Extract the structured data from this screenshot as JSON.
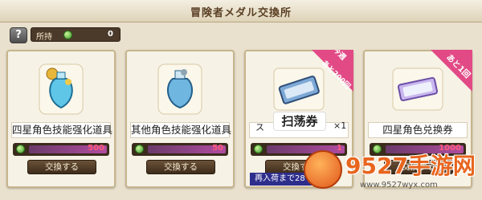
{
  "header": {
    "title": "冒険者メダル交換所"
  },
  "help": {
    "label": "?"
  },
  "holdings": {
    "label": "所持",
    "value": "0",
    "medal_icon": "green-medal-icon"
  },
  "cards": [
    {
      "name": "四星角色技能强化道具",
      "cost": "500",
      "exchange_label": "交換する",
      "icon": "blue-potion-icon"
    },
    {
      "name": "其他角色技能强化道具",
      "cost": "50",
      "exchange_label": "交換する",
      "icon": "blue-potion-icon"
    },
    {
      "name_prefix": "ス",
      "name": "扫荡券",
      "name_suffix": "×1",
      "cost": "1",
      "exchange_label": "交換する",
      "icon": "ticket-icon",
      "ribbon": {
        "line1": "今週",
        "line2": "あと200回"
      },
      "restock": "再入荷まで28"
    },
    {
      "name": "四星角色兑换券",
      "cost": "1000",
      "exchange_label": "交換する",
      "icon": "ticket-icon",
      "ribbon": {
        "line1": "あと1回"
      }
    }
  ],
  "watermark": {
    "text": "9527手游网",
    "url": "www.9527wyx.com"
  },
  "colors": {
    "accent": "#e24a86",
    "panel": "#e9e1cd",
    "button": "#4e3a26"
  }
}
